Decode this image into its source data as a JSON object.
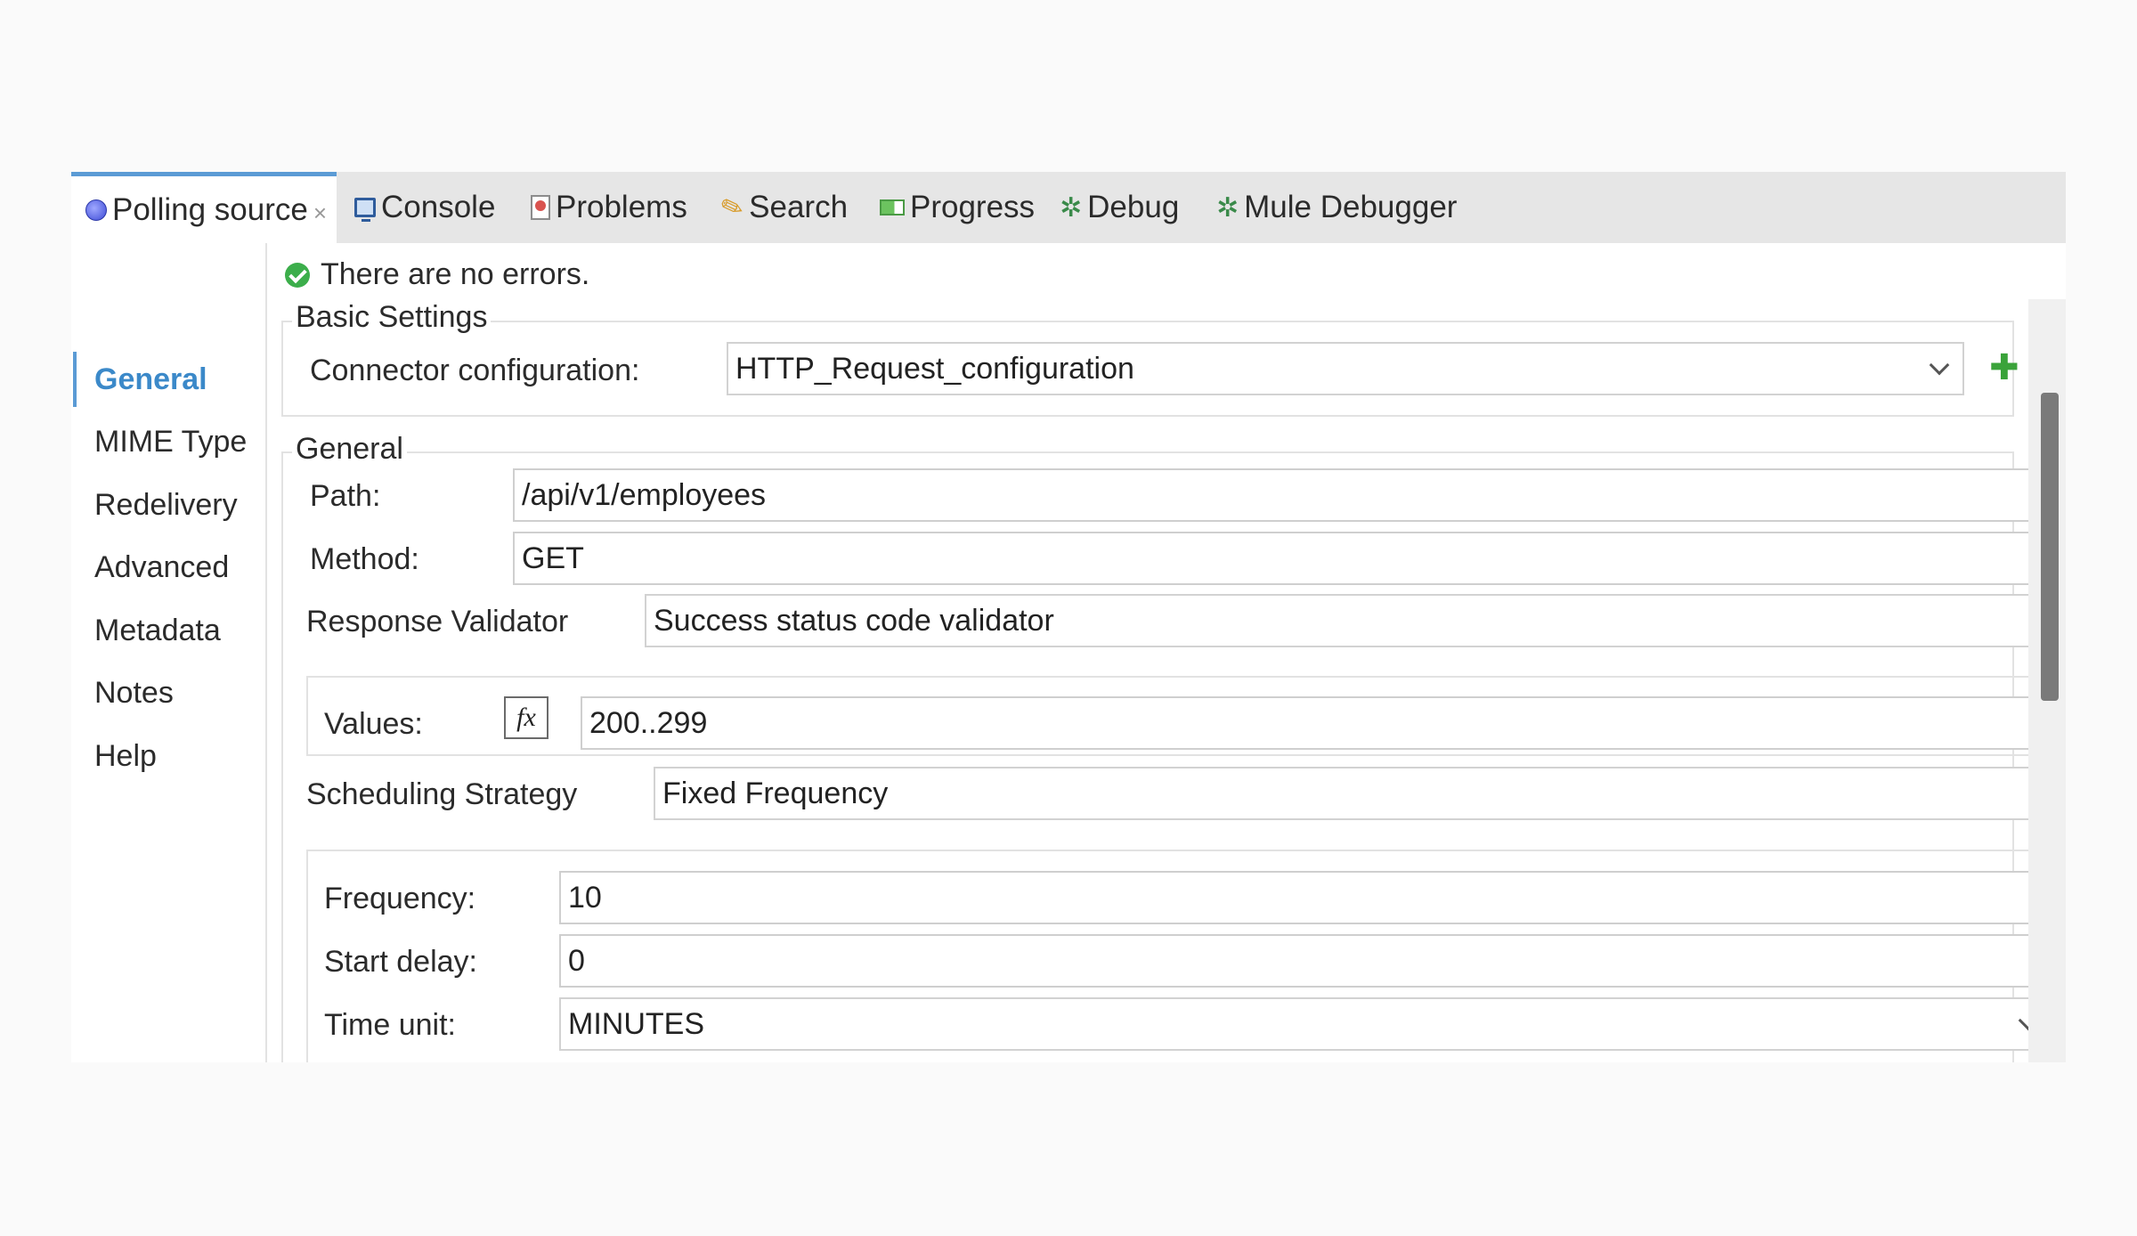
{
  "tabs": [
    {
      "label": "Polling source",
      "icon": "polling-source-icon",
      "active": true
    },
    {
      "label": "Console",
      "icon": "console-icon"
    },
    {
      "label": "Problems",
      "icon": "problems-icon"
    },
    {
      "label": "Search",
      "icon": "search-icon"
    },
    {
      "label": "Progress",
      "icon": "progress-icon"
    },
    {
      "label": "Debug",
      "icon": "debug-icon"
    },
    {
      "label": "Mule Debugger",
      "icon": "mule-debugger-icon"
    }
  ],
  "close_glyph": "×",
  "sidebar": {
    "items": [
      {
        "label": "General",
        "selected": true
      },
      {
        "label": "MIME Type"
      },
      {
        "label": "Redelivery"
      },
      {
        "label": "Advanced"
      },
      {
        "label": "Metadata"
      },
      {
        "label": "Notes"
      },
      {
        "label": "Help"
      }
    ]
  },
  "status": {
    "message": "There are no errors.",
    "color": "#3cae4b"
  },
  "basic_settings": {
    "title": "Basic Settings",
    "connector_label": "Connector configuration:",
    "connector_value": "HTTP_Request_configuration"
  },
  "general": {
    "title": "General",
    "path_label": "Path:",
    "path_value": "/api/v1/employees",
    "method_label": "Method:",
    "method_value": "GET",
    "validator_label": "Response Validator",
    "validator_value": "Success status code validator",
    "values_label": "Values:",
    "fx_label": "fx",
    "values_value": "200..299",
    "scheduling_label": "Scheduling Strategy",
    "scheduling_value": "Fixed Frequency",
    "frequency_label": "Frequency:",
    "frequency_value": "10",
    "start_delay_label": "Start delay:",
    "start_delay_value": "0",
    "time_unit_label": "Time unit:",
    "time_unit_value": "MINUTES"
  },
  "colors": {
    "accent": "#5b9bd5",
    "nav_selected": "#3b89c9",
    "add": "#3aa33a",
    "edit": "#2a5fa8"
  }
}
